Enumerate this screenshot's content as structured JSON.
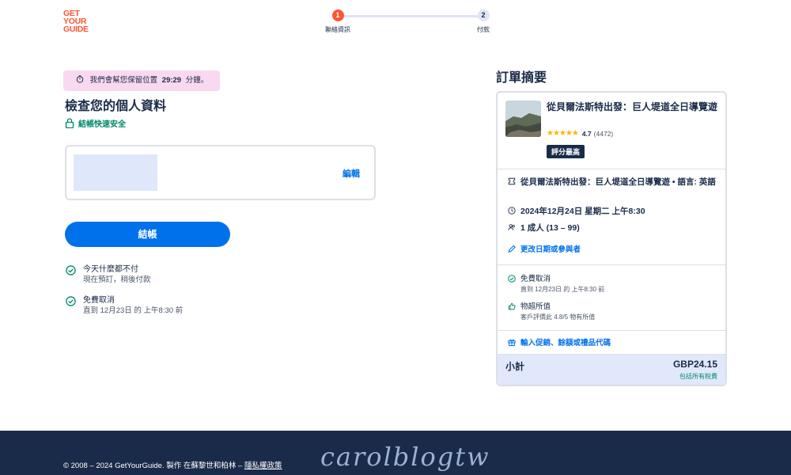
{
  "brand": {
    "logo_lines": [
      "GET",
      "YOUR",
      "GUIDE"
    ],
    "accent": "#ff5533",
    "primary": "#0071eb",
    "navy": "#1a2b49"
  },
  "stepper": {
    "steps": [
      {
        "number": "1",
        "label": "聯絡資訊",
        "active": true
      },
      {
        "number": "2",
        "label": "付款",
        "active": false
      }
    ]
  },
  "timer": {
    "prefix": "我們會幫您保留位置",
    "time": "29:29",
    "suffix": "分鐘。"
  },
  "page_title": "檢查您的個人資料",
  "secure_text": "結帳快速安全",
  "info_card": {
    "edit_label": "編輯"
  },
  "checkout_label": "結帳",
  "benefits": [
    {
      "title": "今天什麼都不付",
      "subtitle": "現在預訂，稍後付款"
    },
    {
      "title": "免費取消",
      "subtitle": "直到 12月23日 的 上午8:30 前"
    }
  ],
  "summary": {
    "heading": "訂單摘要",
    "product_title": "從貝爾法斯特出發：巨人堤道全日導覽遊",
    "rating_value": "4.7",
    "rating_count": "(4472)",
    "rating_stars": 4.7,
    "badge": "評分最高",
    "option": "從貝爾法斯特出發：巨人堤道全日導覽遊 • 語言: 英語",
    "date_time": "2024年12月24日 星期二 上午8:30",
    "participants": "1 成人 (13 – 99)",
    "change_link": "更改日期或參與者",
    "perks": [
      {
        "title": "免費取消",
        "subtitle": "直到 12月23日 的 上午8:30 前"
      },
      {
        "title": "物超所值",
        "subtitle": "客戶評價此 4.8/5 物有所值"
      }
    ],
    "promo_link": "輸入促銷、餘額或禮品代碼",
    "subtotal_label": "小計",
    "subtotal_price": "GBP24.15",
    "tax_note": "包括所有稅費"
  },
  "footer": {
    "copyright": "© 2008 – 2024 GetYourGuide. 製作 在蘇黎世和柏林 –",
    "privacy_link": "隱私權政策",
    "watermark": "carolblogtw"
  }
}
